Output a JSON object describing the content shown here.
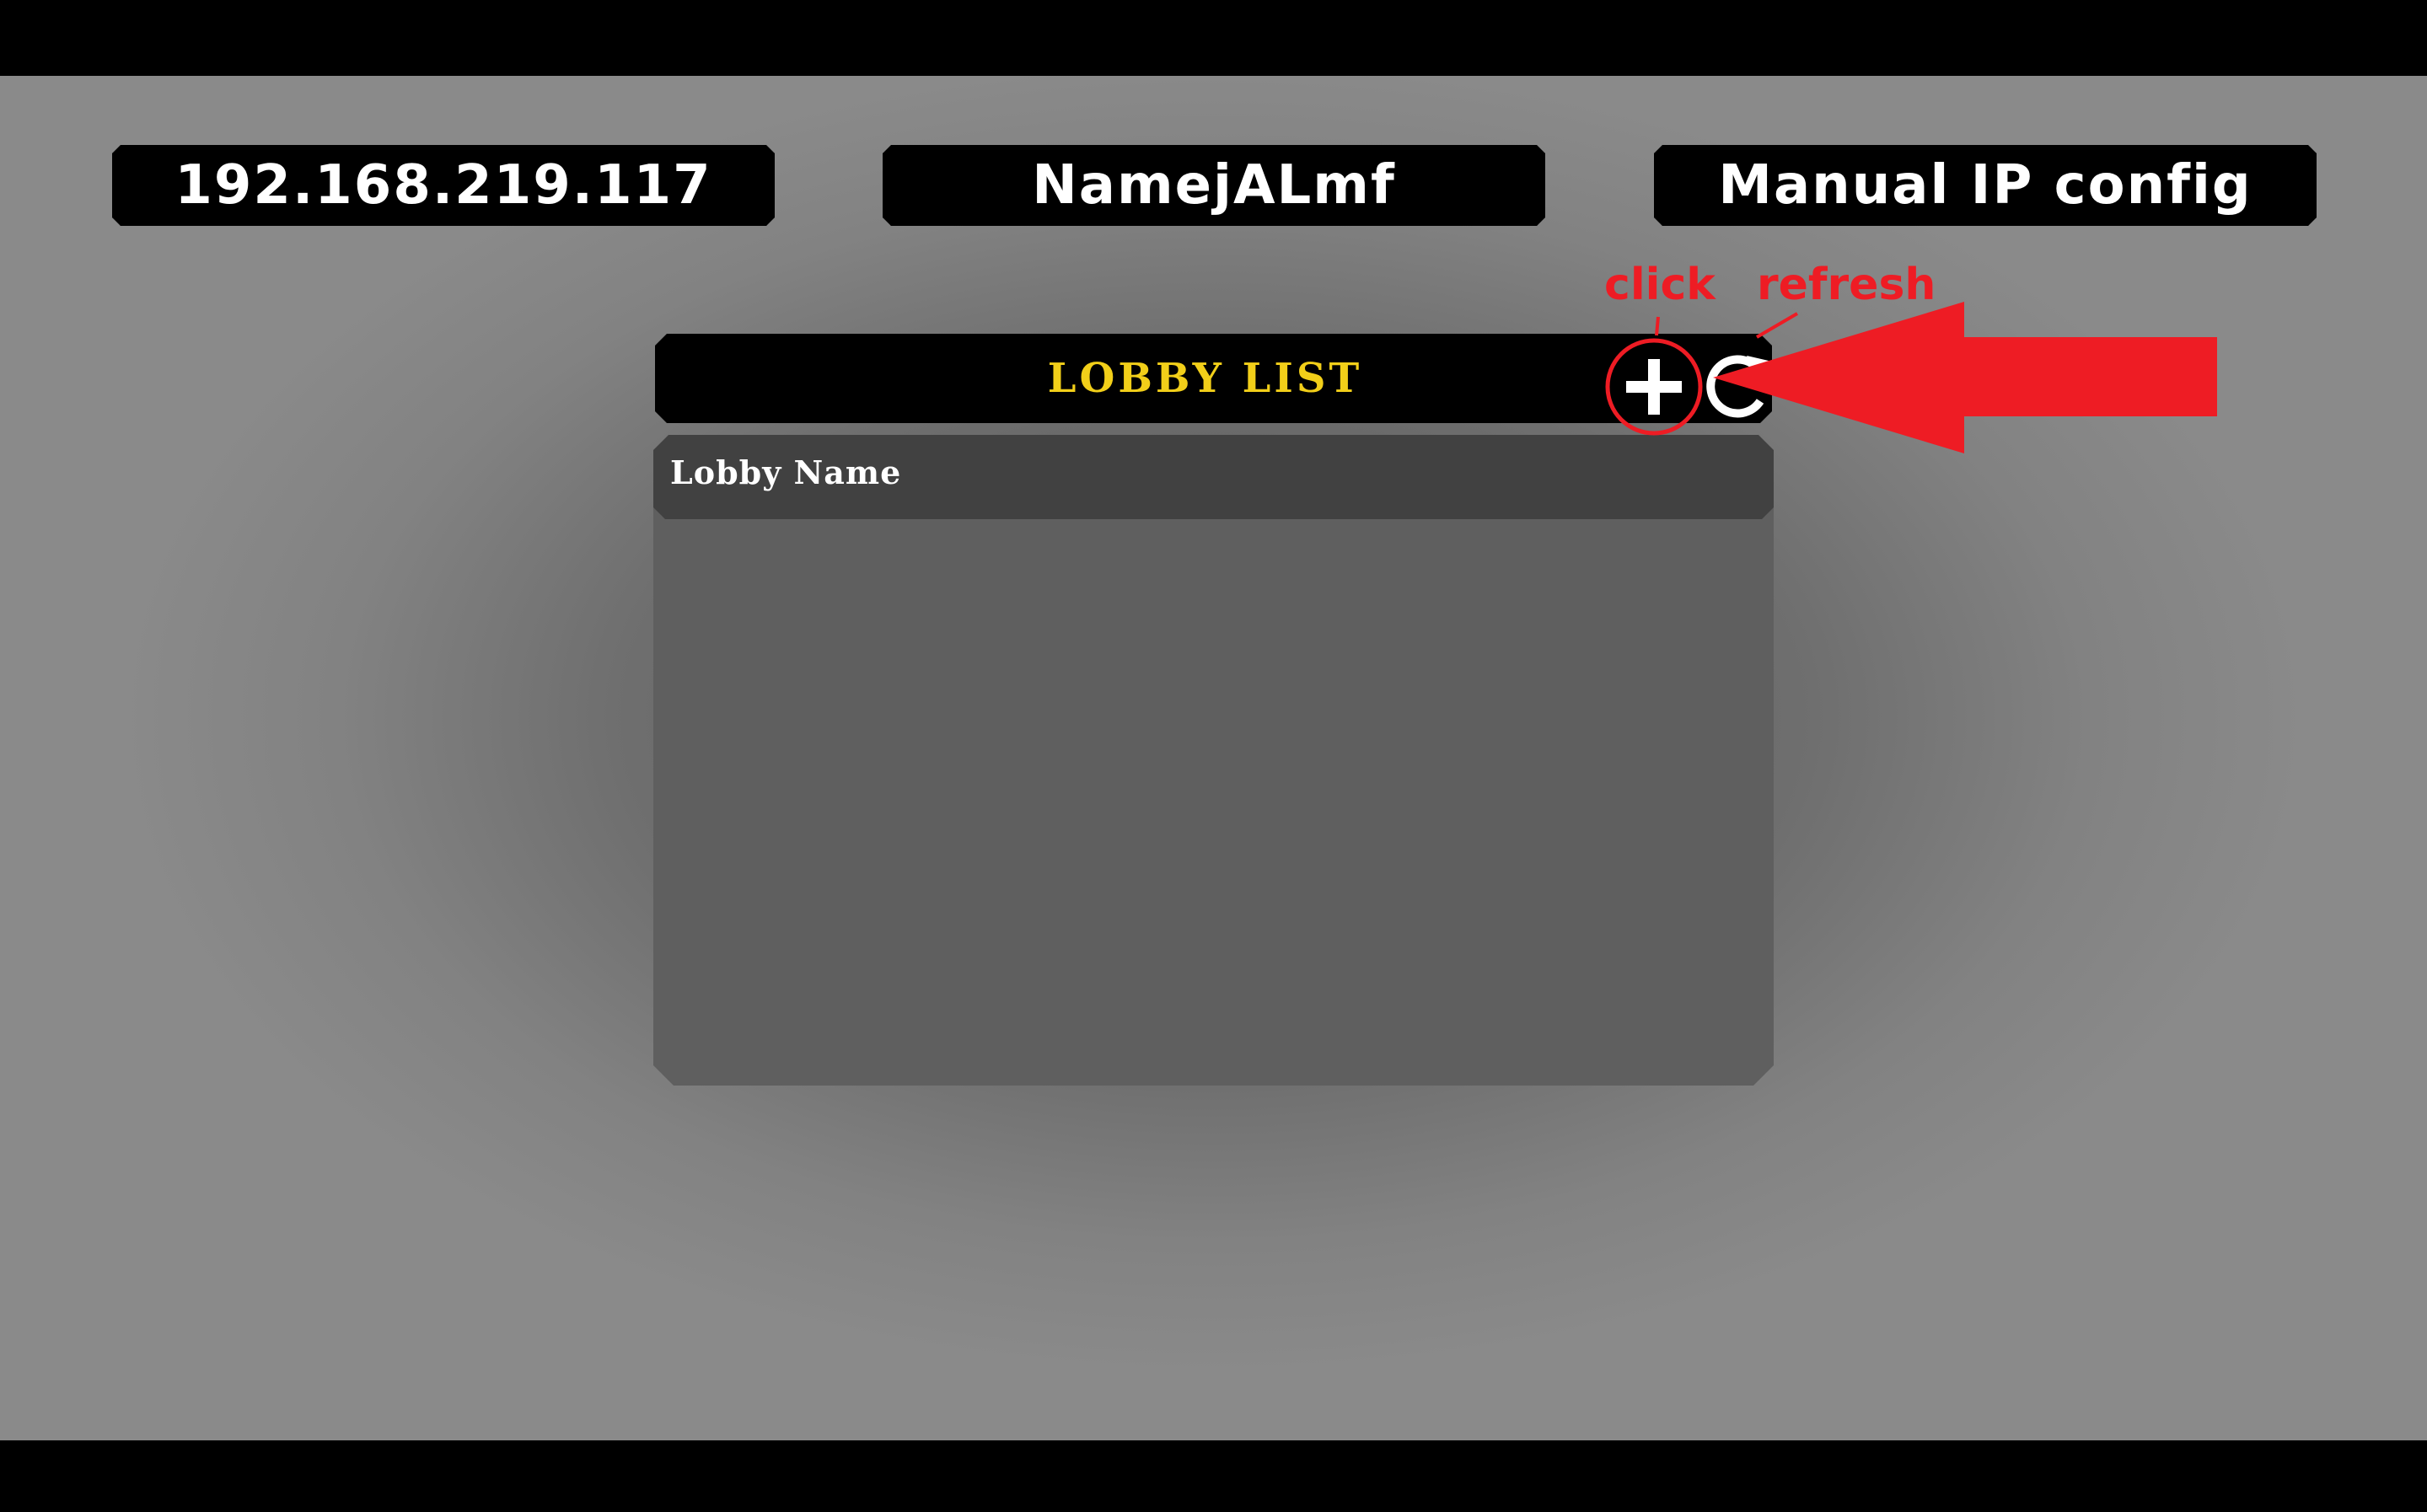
{
  "top_bar": {
    "ip_address": "192.168.219.117",
    "player_name": "NamejALmf",
    "manual_ip_label": "Manual IP config"
  },
  "lobby": {
    "title": "LOBBY LIST",
    "column_header": "Lobby Name",
    "rows": []
  },
  "annotations": {
    "click_label": "click",
    "refresh_label": "refresh",
    "color": "#ee1c24"
  },
  "icons": {
    "create": "plus-icon",
    "refresh": "refresh-icon",
    "pointer": "arrow-icon"
  },
  "colors": {
    "title_yellow": "#f2cf19",
    "panel_bg": "#5f5f5f",
    "header_row_bg": "#414141"
  }
}
